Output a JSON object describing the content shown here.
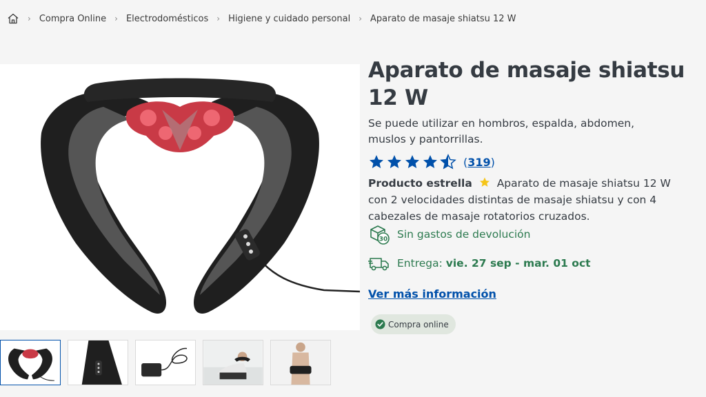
{
  "breadcrumb": {
    "home_icon": "home-icon",
    "items": [
      "Compra Online",
      "Electrodomésticos",
      "Higiene y cuidado personal",
      "Aparato de masaje shiatsu 12 W"
    ]
  },
  "product": {
    "title": "Aparato de masaje shiatsu 12 W",
    "subtitle": "Se puede utilizar en hombros, espalda, abdomen, muslos y pantorrillas.",
    "rating": {
      "stars": 4.5,
      "count_open": "(",
      "count": "319",
      "count_close": ")"
    },
    "highlight_label": "Producto estrella",
    "description": "Aparato de masaje shiatsu 12 W con 2 velocidades distintas de masaje shiatsu y con 4 cabezales de masaje rotatorios cruzados."
  },
  "features": {
    "returns": {
      "icon": "box-return-30-icon",
      "text": "Sin gastos de devolución"
    },
    "delivery": {
      "icon": "delivery-truck-icon",
      "label": "Entrega: ",
      "dates": "vie. 27 sep - mar. 01 oct"
    }
  },
  "more_info_link": "Ver más información",
  "badge": {
    "icon": "check-circle-icon",
    "text": "Compra online"
  },
  "thumbnails": [
    "massager-front",
    "massager-controls",
    "power-adapter",
    "person-neck-use",
    "person-back-use"
  ],
  "colors": {
    "brand_blue": "#0050aa",
    "green": "#2c7a4f",
    "star_blue": "#0050aa",
    "text": "#353b42"
  }
}
